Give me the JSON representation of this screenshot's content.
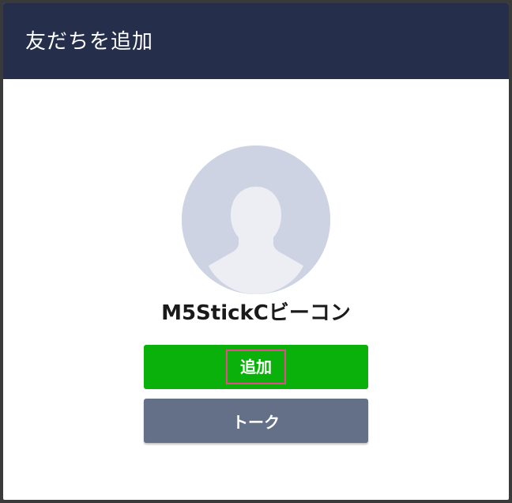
{
  "header": {
    "title": "友だちを追加"
  },
  "profile": {
    "name": "M5StickCビーコン",
    "avatar_icon": "person-silhouette-icon"
  },
  "actions": {
    "add_label": "追加",
    "talk_label": "トーク"
  },
  "colors": {
    "header_bg": "#252f4c",
    "add_button": "#0ab10a",
    "talk_button": "#637087",
    "avatar_bg": "#cdd3e2",
    "highlight_border": "#e64a8a"
  }
}
